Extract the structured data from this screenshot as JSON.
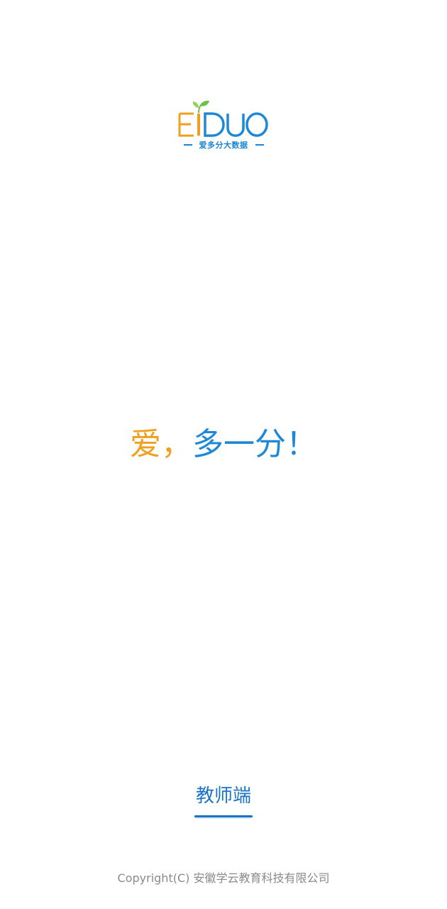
{
  "logo": {
    "wordmark": "EIDUO",
    "subtitle": "爱多分大数据",
    "colors": {
      "orange": "#f0a01e",
      "blue": "#1e88d8",
      "leaf": "#6cc24a"
    },
    "icon": "leaf-icon"
  },
  "slogan": {
    "part1": "爱",
    "comma": "，",
    "part2": "多一分！",
    "color_part1": "#f0a01e",
    "color_part2": "#1e88d8"
  },
  "role_tab": {
    "label": "教师端",
    "selected": true,
    "accent": "#1b74c4"
  },
  "footer": {
    "copyright": "Copyright(C) 安徽学云教育科技有限公司"
  }
}
